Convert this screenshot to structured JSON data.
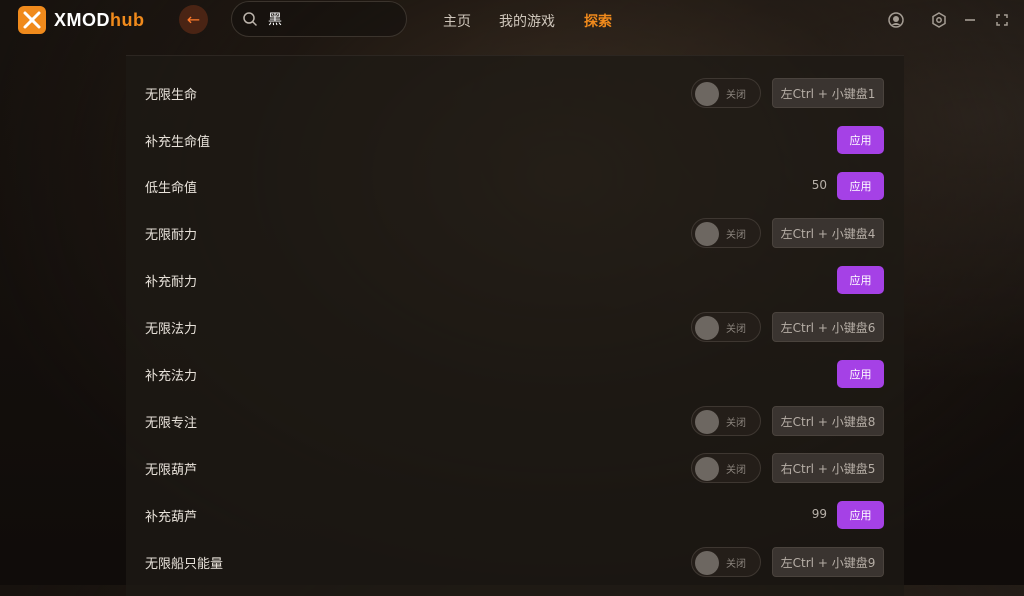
{
  "app": {
    "brand_main": "XMOD",
    "brand_accent": "hub",
    "accent_color": "#f08a1c",
    "apply_color": "#a541e6"
  },
  "search": {
    "value": "黑",
    "placeholder": ""
  },
  "nav": [
    {
      "label": "主页",
      "active": false
    },
    {
      "label": "我的游戏",
      "active": false
    },
    {
      "label": "探索",
      "active": true
    }
  ],
  "window_controls": [
    "user-icon",
    "settings-hexagon-icon",
    "minimize-icon",
    "fullscreen-icon"
  ],
  "cheats": [
    {
      "name": "无限生命",
      "toggle": "关闭",
      "hotkey": "左Ctrl + 小键盘1"
    },
    {
      "name": "补充生命值",
      "apply": "应用"
    },
    {
      "name": "低生命值",
      "value": "50",
      "apply": "应用"
    },
    {
      "name": "无限耐力",
      "toggle": "关闭",
      "hotkey": "左Ctrl + 小键盘4"
    },
    {
      "name": "补充耐力",
      "apply": "应用"
    },
    {
      "name": "无限法力",
      "toggle": "关闭",
      "hotkey": "左Ctrl + 小键盘6"
    },
    {
      "name": "补充法力",
      "apply": "应用"
    },
    {
      "name": "无限专注",
      "toggle": "关闭",
      "hotkey": "左Ctrl + 小键盘8"
    },
    {
      "name": "无限葫芦",
      "toggle": "关闭",
      "hotkey": "右Ctrl + 小键盘5"
    },
    {
      "name": "补充葫芦",
      "value": "99",
      "apply": "应用"
    },
    {
      "name": "无限船只能量",
      "toggle": "关闭",
      "hotkey": "左Ctrl + 小键盘9"
    }
  ]
}
